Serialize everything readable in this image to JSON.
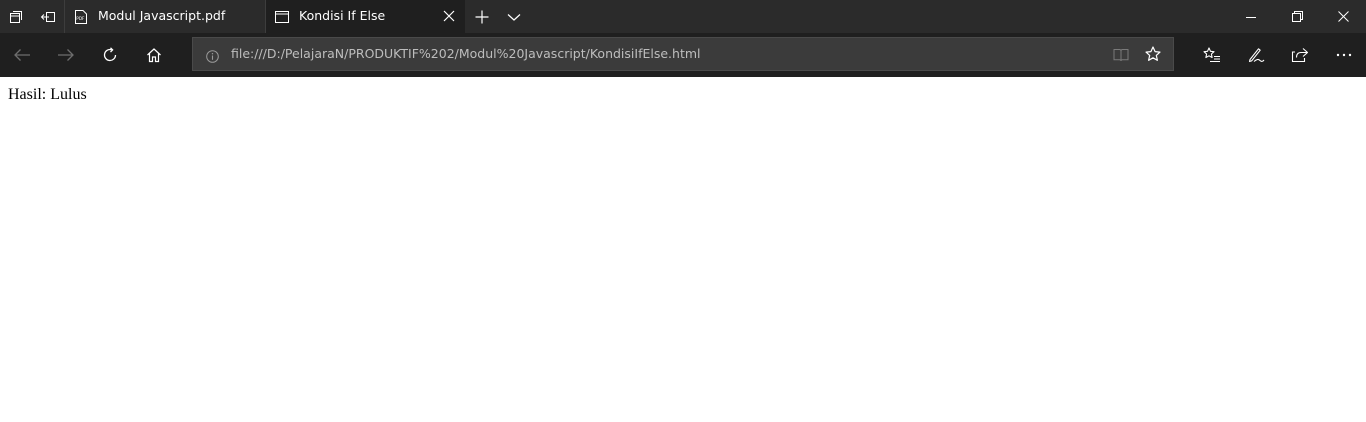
{
  "colors": {
    "titlebar_bg": "#2b2b2b",
    "active_tab_bg": "#1f1f1f",
    "toolbar_bg": "#1f1f1f",
    "addressbar_bg": "#3b3b3b",
    "page_bg": "#ffffff"
  },
  "titlebar": {
    "left_icons": [
      "tab-manager-icon",
      "set-aside-tabs-icon"
    ],
    "tabs": [
      {
        "title": "Modul Javascript.pdf",
        "icon": "pdf-icon",
        "active": false
      },
      {
        "title": "Kondisi If Else",
        "icon": "page-icon",
        "active": true,
        "close_icon": "close-icon"
      }
    ],
    "new_tab_icon": "plus-icon",
    "tab_preview_icon": "chevron-down-icon",
    "window_controls": [
      "minimize-icon",
      "restore-icon",
      "close-icon"
    ]
  },
  "toolbar": {
    "nav_icons": [
      "back-arrow-icon",
      "forward-arrow-icon",
      "refresh-icon",
      "home-icon"
    ],
    "address": {
      "url": "file:///D:/PelajaraN/PRODUKTIF%202/Modul%20Javascript/KondisiIfElse.html",
      "info_icon": "info-icon",
      "reading_view_icon": "book-icon",
      "favorite_icon": "star-icon"
    },
    "right_icons": [
      "favorites-list-icon",
      "pen-icon",
      "share-icon",
      "more-icon"
    ]
  },
  "page": {
    "text": "Hasil: Lulus"
  }
}
